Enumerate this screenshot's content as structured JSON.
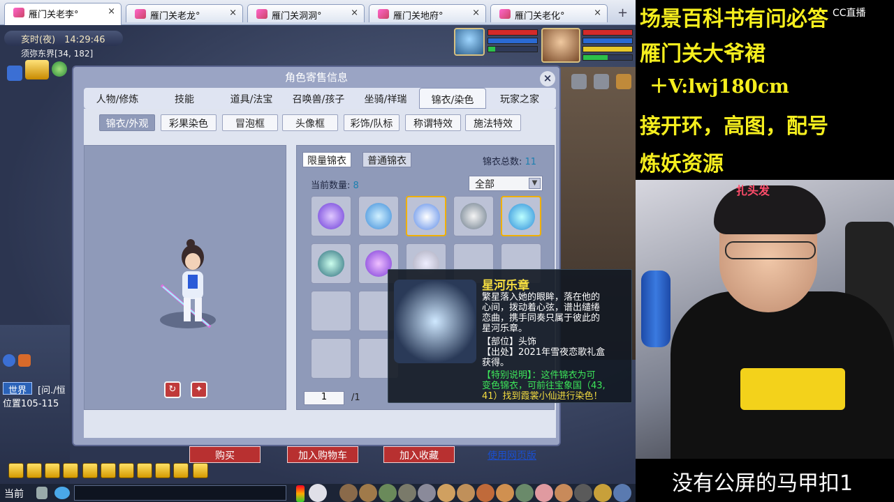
{
  "browser_tabs": [
    {
      "label": "雁门关老李°",
      "close": "×"
    },
    {
      "label": "雁门关老龙°",
      "close": "×"
    },
    {
      "label": "雁门关洞洞°",
      "close": "×"
    },
    {
      "label": "雁门关地府°",
      "close": "×"
    },
    {
      "label": "雁门关老化°",
      "close": "×"
    }
  ],
  "tab_add": "+",
  "hud": {
    "clock": "亥时(夜)　14:29:46",
    "map": "须弥东界[34, 182]"
  },
  "dialog": {
    "title": "角色寄售信息",
    "close": "×",
    "main_tabs": [
      "人物/修炼",
      "技能",
      "道具/法宝",
      "召唤兽/孩子",
      "坐骑/祥瑞",
      "锦衣/染色",
      "玩家之家"
    ],
    "sub_tabs": [
      "锦衣/外观",
      "彩果染色",
      "冒泡框",
      "头像框",
      "彩饰/队标",
      "称谓特效",
      "施法特效"
    ],
    "preview_buttons": [
      "rotate",
      "pose"
    ],
    "right": {
      "tabs": [
        "限量锦衣",
        "普通锦衣"
      ],
      "total_label": "锦衣总数:",
      "total_value": "11",
      "current_label": "当前数量:",
      "current_value": "8",
      "filter": "全部",
      "page": "1",
      "page_total": "/1"
    },
    "buttons": {
      "buy": "购买",
      "cart": "加入购物车",
      "fav": "加入收藏",
      "web": "使用网页版"
    }
  },
  "tooltip": {
    "title": "星河乐章",
    "lines": [
      "繁星落入她的眼眸，落在他的",
      "心间，拨动着心弦，谱出缱绻",
      "恋曲，携手同奏只属于彼此的",
      "星河乐章。",
      "【部位】头饰",
      "【出处】2021年雪夜恋歌礼盒",
      "获得。"
    ],
    "special": [
      "【特别说明】：这件锦衣为可",
      "变色锦衣，可前往宝象国（43,",
      "41）找到霞裳小仙进行染色！"
    ]
  },
  "chat": {
    "channel": "世界",
    "text": "[问./恒",
    "position": "位置105-115",
    "current": "当前"
  },
  "stream": {
    "lines": [
      "场景百科书有问必答",
      "雁门关大爷裙",
      "＋V:lwj180cm",
      "接开环，高图，配号",
      "炼妖资源"
    ],
    "logo": "CC直播",
    "sign": "扎头发",
    "bottom_note": "没有公屏的马甲扣1"
  },
  "colors": {
    "accent_yellow": "#f5ee1e",
    "special_green": "#3de65a",
    "dialog_bg": "#9aa4c4"
  }
}
